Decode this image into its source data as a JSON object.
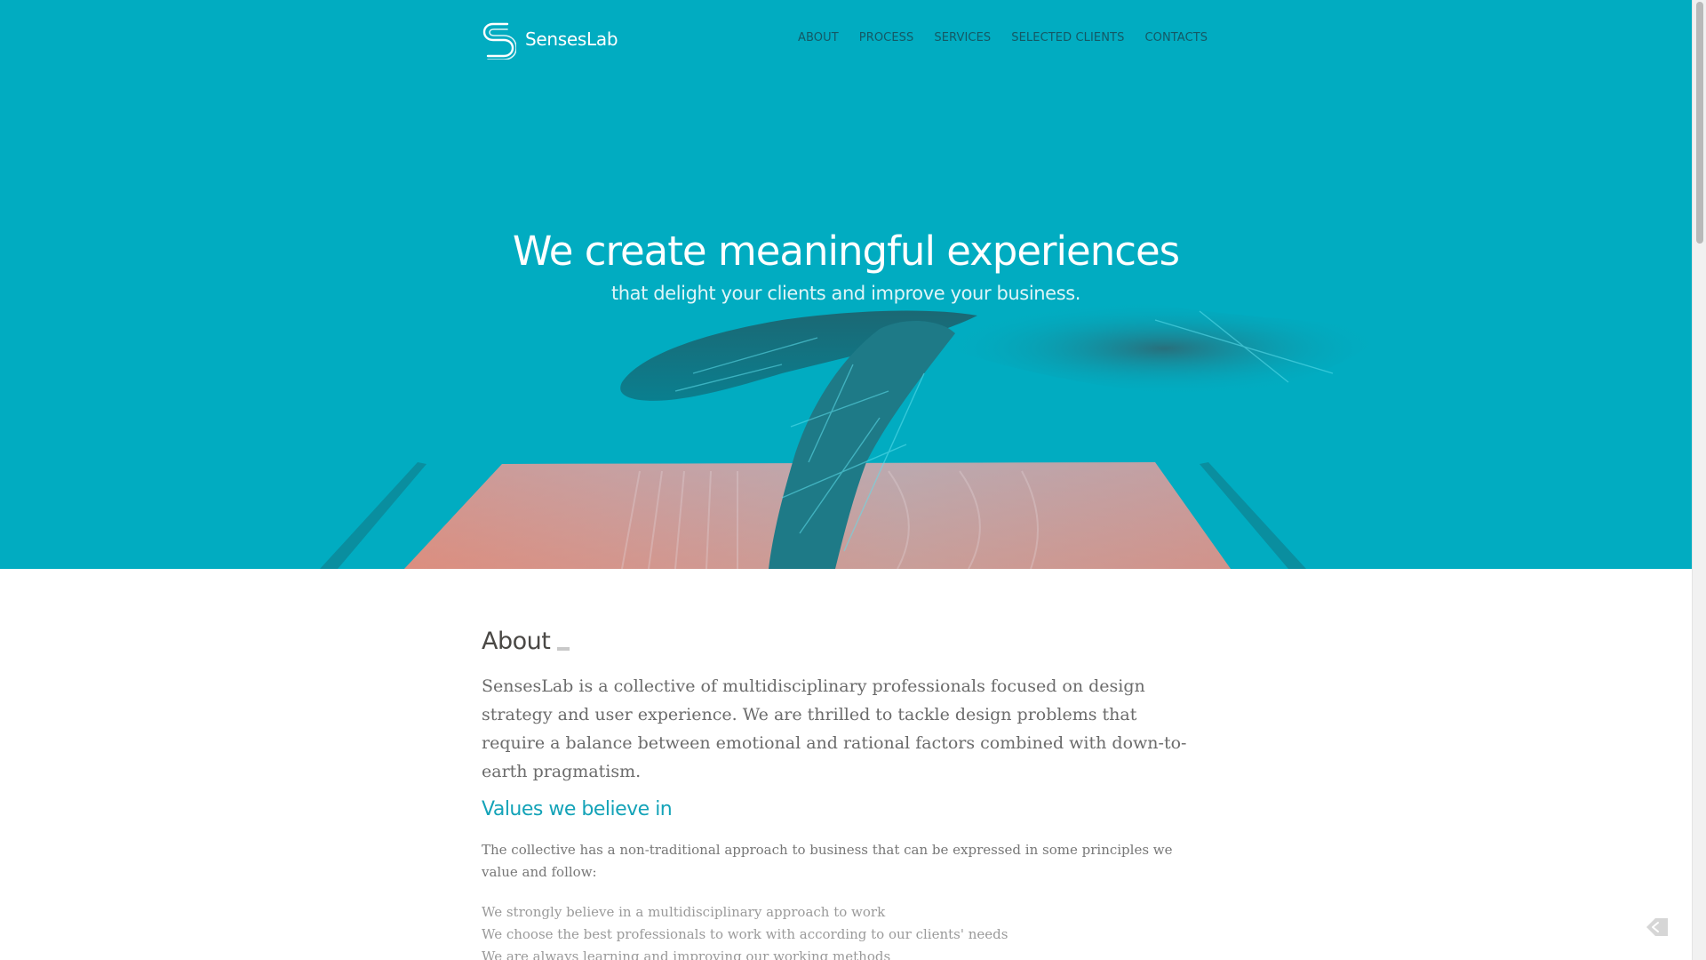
{
  "brand": {
    "name": "SensesLab",
    "logo_icon": "senseslab-logo-icon"
  },
  "nav": {
    "items": [
      {
        "label": "ABOUT"
      },
      {
        "label": "PROCESS"
      },
      {
        "label": "SERVICES"
      },
      {
        "label": "SELECTED CLIENTS"
      },
      {
        "label": "CONTACTS"
      }
    ]
  },
  "hero": {
    "title": "We create meaningful experiences",
    "subtitle": "that delight your clients and improve your business.",
    "image": "hand-touching-tablet-illustration"
  },
  "about": {
    "heading": "About",
    "text": "SensesLab is a collective of multidisciplinary professionals focused on design strategy and user experience. We are thrilled to tackle design problems that require a balance between emotional and rational factors combined with down-to-earth pragmatism."
  },
  "values": {
    "heading": "Values we believe in",
    "intro": "The collective has a non-traditional approach to business that can be expressed in some principles we value and follow:",
    "items": [
      "We strongly believe in a multidisciplinary approach to work",
      "We choose the best professionals to work with according to our clients' needs",
      "We are always learning and improving our working methods"
    ]
  },
  "colors": {
    "hero_bg": "#01acc1",
    "accent": "#14a3b8",
    "nav_text": "#145965",
    "body_text": "#6b6b6b"
  },
  "floating_icon": "tag-icon"
}
